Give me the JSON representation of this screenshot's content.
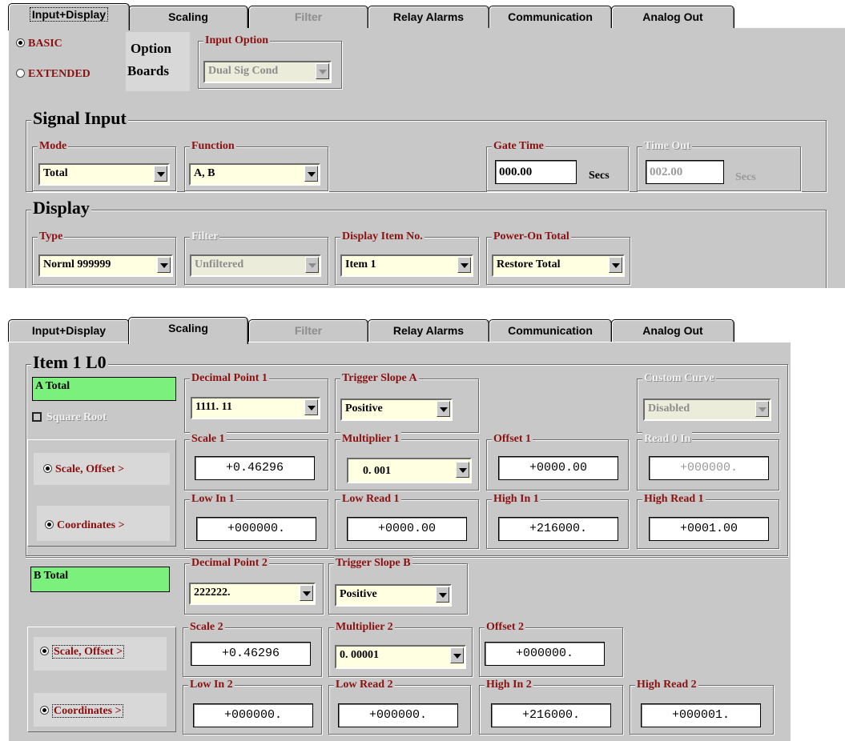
{
  "tabs": [
    "Input+Display",
    "Scaling",
    "Filter",
    "Relay Alarms",
    "Communication",
    "Analog Out"
  ],
  "top": {
    "radio_basic": "BASIC",
    "radio_extended": "EXTENDED",
    "option_label_1": "Option",
    "option_label_2": "Boards",
    "input_option_title": "Input Option",
    "input_option_value": "Dual Sig Cond",
    "signal_input_title": "Signal Input",
    "mode_title": "Mode",
    "mode_value": "Total",
    "function_title": "Function",
    "function_value": "A, B",
    "gate_time_title": "Gate Time",
    "gate_time_value": "000.00",
    "gate_time_unit": "Secs",
    "time_out_title": "Time Out",
    "time_out_value": "002.00",
    "time_out_unit": "Secs",
    "display_title": "Display",
    "type_title": "Type",
    "type_value": "Norml 999999",
    "filter_title": "Filter",
    "filter_value": "Unfiltered",
    "display_item_title": "Display Item No.",
    "display_item_value": "Item 1",
    "power_on_title": "Power-On Total",
    "power_on_value": "Restore Total"
  },
  "bottom": {
    "item_title": "Item 1  L0",
    "a_total": "A Total",
    "square_root": "Square Root",
    "decimal_point_1_title": "Decimal Point 1",
    "decimal_point_1_value": "1111. 11",
    "trigger_slope_a_title": "Trigger Slope A",
    "trigger_slope_a_value": "Positive",
    "custom_curve_title": "Custom Curve",
    "custom_curve_value": "Disabled",
    "radio_scale_offset": "Scale, Offset >",
    "radio_coordinates": "Coordinates  >",
    "scale_1_title": "Scale 1",
    "scale_1_value": "+0.46296",
    "multiplier_1_title": "Multiplier 1",
    "multiplier_1_value": "0. 001",
    "offset_1_title": "Offset 1",
    "offset_1_value": "+0000.00",
    "read_0_in_title": "Read 0 In",
    "read_0_in_value": "+000000.",
    "low_in_1_title": "Low In 1",
    "low_in_1_value": "+000000.",
    "low_read_1_title": "Low Read 1",
    "low_read_1_value": "+0000.00",
    "high_in_1_title": "High In 1",
    "high_in_1_value": "+216000.",
    "high_read_1_title": "High Read 1",
    "high_read_1_value": "+0001.00",
    "b_total": "B Total",
    "decimal_point_2_title": "Decimal Point 2",
    "decimal_point_2_value": "222222.",
    "trigger_slope_b_title": "Trigger Slope B",
    "trigger_slope_b_value": "Positive",
    "scale_2_title": "Scale 2",
    "scale_2_value": "+0.46296",
    "multiplier_2_title": "Multiplier 2",
    "multiplier_2_value": "0. 00001",
    "offset_2_title": "Offset 2",
    "offset_2_value": "+000000.",
    "low_in_2_title": "Low In 2",
    "low_in_2_value": "+000000.",
    "low_read_2_title": "Low Read 2",
    "low_read_2_value": "+000000.",
    "high_in_2_title": "High In 2",
    "high_in_2_value": "+216000.",
    "high_read_2_title": "High Read 2",
    "high_read_2_value": "+000001."
  },
  "colors": {
    "panel": "#c8c8c8",
    "title_red": "#8b1010",
    "field_yellow": "#ffffe1",
    "green": "#7cf07c"
  }
}
